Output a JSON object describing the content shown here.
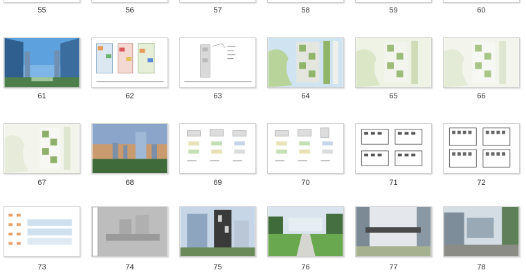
{
  "thumbnails": [
    {
      "label": "55"
    },
    {
      "label": "56"
    },
    {
      "label": "57"
    },
    {
      "label": "58"
    },
    {
      "label": "59"
    },
    {
      "label": "60"
    },
    {
      "label": "61",
      "kind": "photo-towers"
    },
    {
      "label": "62",
      "kind": "colored-plans"
    },
    {
      "label": "63",
      "kind": "sparse-plan"
    },
    {
      "label": "64",
      "kind": "site-plan-color"
    },
    {
      "label": "65",
      "kind": "site-plan-pale"
    },
    {
      "label": "66",
      "kind": "site-plan-pale"
    },
    {
      "label": "67",
      "kind": "site-plan-pale"
    },
    {
      "label": "68",
      "kind": "photo-skyline"
    },
    {
      "label": "69",
      "kind": "elevations"
    },
    {
      "label": "70",
      "kind": "elevations"
    },
    {
      "label": "71",
      "kind": "floor-plans"
    },
    {
      "label": "72",
      "kind": "floor-plans"
    },
    {
      "label": "73",
      "kind": "section-sheet"
    },
    {
      "label": "74",
      "kind": "gray-elevation"
    },
    {
      "label": "75",
      "kind": "photo-building"
    },
    {
      "label": "76",
      "kind": "photo-lawn"
    },
    {
      "label": "77",
      "kind": "photo-bridge"
    },
    {
      "label": "78",
      "kind": "photo-street"
    }
  ]
}
